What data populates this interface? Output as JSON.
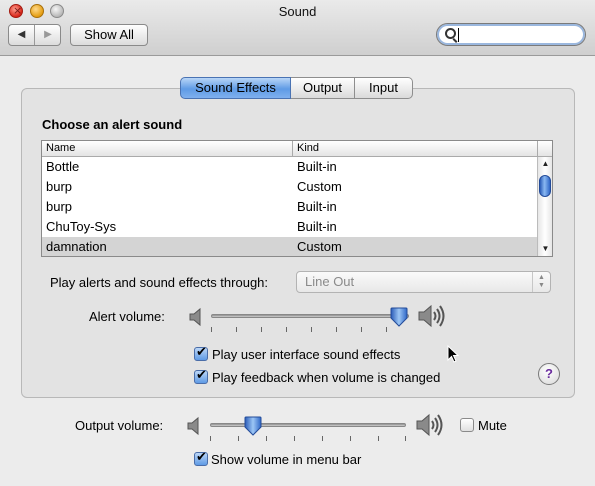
{
  "window": {
    "title": "Sound",
    "show_all_label": "Show All",
    "search": {
      "placeholder": "",
      "value": ""
    }
  },
  "tabs": [
    {
      "label": "Sound Effects",
      "active": true
    },
    {
      "label": "Output",
      "active": false
    },
    {
      "label": "Input",
      "active": false
    }
  ],
  "alerts": {
    "section_title": "Choose an alert sound",
    "columns": [
      "Name",
      "Kind"
    ],
    "rows": [
      {
        "name": "Bottle",
        "kind": "Built-in"
      },
      {
        "name": "burp",
        "kind": "Custom"
      },
      {
        "name": "burp",
        "kind": "Built-in"
      },
      {
        "name": "ChuToy-Sys",
        "kind": "Built-in"
      },
      {
        "name": "damnation",
        "kind": "Custom",
        "selected": true
      }
    ]
  },
  "play_through": {
    "label": "Play alerts and sound effects through:",
    "selected": "Line Out"
  },
  "alert_volume": {
    "label": "Alert volume:",
    "level": 0.95
  },
  "options": {
    "ui_sounds": {
      "label": "Play user interface sound effects",
      "checked": true
    },
    "feedback": {
      "label": "Play feedback when volume is changed",
      "checked": true
    }
  },
  "help_label": "?",
  "output_volume": {
    "label": "Output volume:",
    "level": 0.22
  },
  "mute": {
    "label": "Mute",
    "checked": false
  },
  "menu_bar": {
    "label": "Show volume in menu bar",
    "checked": true
  },
  "icons": {
    "speaker_low": "speaker-low-icon",
    "speaker_high": "speaker-high-icon",
    "search": "search-icon",
    "help": "help-icon"
  },
  "colors": {
    "accent": "#5f9be5",
    "selected_row": "#d4d4d4",
    "help_q": "#6a2c9e"
  }
}
